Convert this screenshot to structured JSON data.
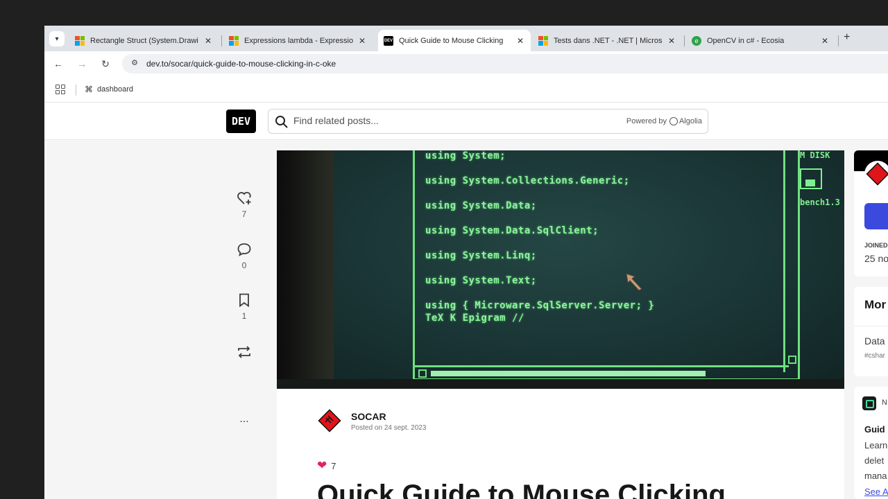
{
  "browser": {
    "tabs": [
      {
        "label": "Rectangle Struct (System.Drawi",
        "favicon": "microsoft-icon",
        "active": false
      },
      {
        "label": "Expressions lambda - Expressio",
        "favicon": "microsoft-icon",
        "active": false
      },
      {
        "label": "Quick Guide to Mouse Clicking",
        "favicon": "dev-icon",
        "active": true
      },
      {
        "label": "Tests dans .NET - .NET | Micros",
        "favicon": "microsoft-icon",
        "active": false
      },
      {
        "label": "OpenCV in c# - Ecosia",
        "favicon": "ecosia-icon",
        "active": false
      }
    ],
    "tab_close": "✕",
    "new_tab": "+",
    "url": "dev.to/socar/quick-guide-to-mouse-clicking-in-c-oke",
    "bookmarks": [
      {
        "label": "dashboard",
        "icon": "github-icon"
      }
    ]
  },
  "header": {
    "logo": "DEV",
    "search_placeholder": "Find related posts...",
    "powered_by": "Powered by",
    "algolia": "Algolia"
  },
  "actions": {
    "reactions": "7",
    "comments": "0",
    "saves": "1",
    "more": "..."
  },
  "hero": {
    "code_lines": [
      "using System;",
      "using System.Collections.Generic;",
      "using System.Data;",
      "using System.Data.SqlClient;",
      "using System.Linq;",
      "using System.Text;",
      "using { Microware.SqlServer.Server; }",
      "TeX K Epigram //"
    ],
    "disk_label": "M DISK",
    "bench_label": "bench1.3"
  },
  "article": {
    "author": "SOCAR",
    "posted": "Posted on 24 sept. 2023",
    "reaction_count": "7",
    "title": "Quick Guide to Mouse Clicking"
  },
  "right_sidebar": {
    "joined_label": "JOINED",
    "joined_date": "25 no",
    "more_from": "Mor",
    "related_title": "Data",
    "related_tag": "#cshar",
    "sponsor_label": "N",
    "guide_title": "Guid",
    "guide_lines": [
      "Learn",
      "delet",
      "mana"
    ],
    "see_all": "See A"
  },
  "colors": {
    "dev_blue": "#3b49df",
    "terminal_green": "#8af59a"
  }
}
